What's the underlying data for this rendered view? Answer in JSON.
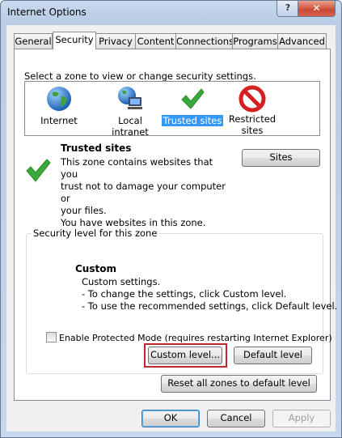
{
  "window": {
    "title": "Internet Options",
    "help_label": "?",
    "close_label": "✕"
  },
  "tabs": [
    {
      "label": "General"
    },
    {
      "label": "Security"
    },
    {
      "label": "Privacy"
    },
    {
      "label": "Content"
    },
    {
      "label": "Connections"
    },
    {
      "label": "Programs"
    },
    {
      "label": "Advanced"
    }
  ],
  "active_tab": "Security",
  "security": {
    "prompt": "Select a zone to view or change security settings.",
    "zones": [
      {
        "label": "Internet",
        "icon": "globe-icon"
      },
      {
        "label": "Local intranet",
        "icon": "intranet-icon"
      },
      {
        "label": "Trusted sites",
        "icon": "checkmark-icon"
      },
      {
        "label": "Restricted",
        "label2": "sites",
        "icon": "no-entry-icon"
      }
    ],
    "selected_zone": "Trusted sites",
    "zone_info": {
      "title": "Trusted sites",
      "desc_lines": [
        "This zone contains websites that you",
        "trust not to damage your computer or",
        "your files.",
        "You have websites in this zone."
      ],
      "sites_button": "Sites"
    },
    "level_group": {
      "label": "Security level for this zone",
      "title": "Custom",
      "lines": [
        "Custom settings.",
        "- To change the settings, click Custom level.",
        "- To use the recommended settings, click Default level."
      ],
      "protected_mode_label": "Enable Protected Mode (requires restarting Internet Explorer)",
      "custom_level_button": "Custom level...",
      "default_level_button": "Default level"
    },
    "reset_button": "Reset all zones to default level"
  },
  "footer": {
    "ok": "OK",
    "cancel": "Cancel",
    "apply": "Apply"
  },
  "colors": {
    "selection": "#3399ff",
    "highlight": "#c0282e",
    "checkmark": "#3aa83a"
  }
}
